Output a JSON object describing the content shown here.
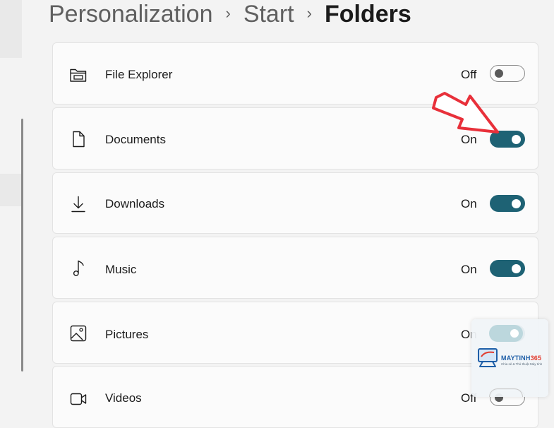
{
  "breadcrumb": {
    "items": [
      "Personalization",
      "Start",
      "Folders"
    ],
    "separator": "›"
  },
  "folders": [
    {
      "label": "File Explorer",
      "state": "Off",
      "on": false,
      "icon": "file-explorer-icon"
    },
    {
      "label": "Documents",
      "state": "On",
      "on": true,
      "icon": "document-icon"
    },
    {
      "label": "Downloads",
      "state": "On",
      "on": true,
      "icon": "download-icon"
    },
    {
      "label": "Music",
      "state": "On",
      "on": true,
      "icon": "music-note-icon"
    },
    {
      "label": "Pictures",
      "state": "On",
      "on": true,
      "icon": "picture-icon"
    },
    {
      "label": "Videos",
      "state": "Off",
      "on": false,
      "icon": "video-icon"
    }
  ],
  "watermark": {
    "brand_main": "MAYTINH",
    "brand_accent": "365",
    "tagline": "Chia sẻ & Thủ thuật Máy tính"
  },
  "colors": {
    "toggle_on": "#1e6274",
    "annotation_arrow": "#e8303a"
  }
}
